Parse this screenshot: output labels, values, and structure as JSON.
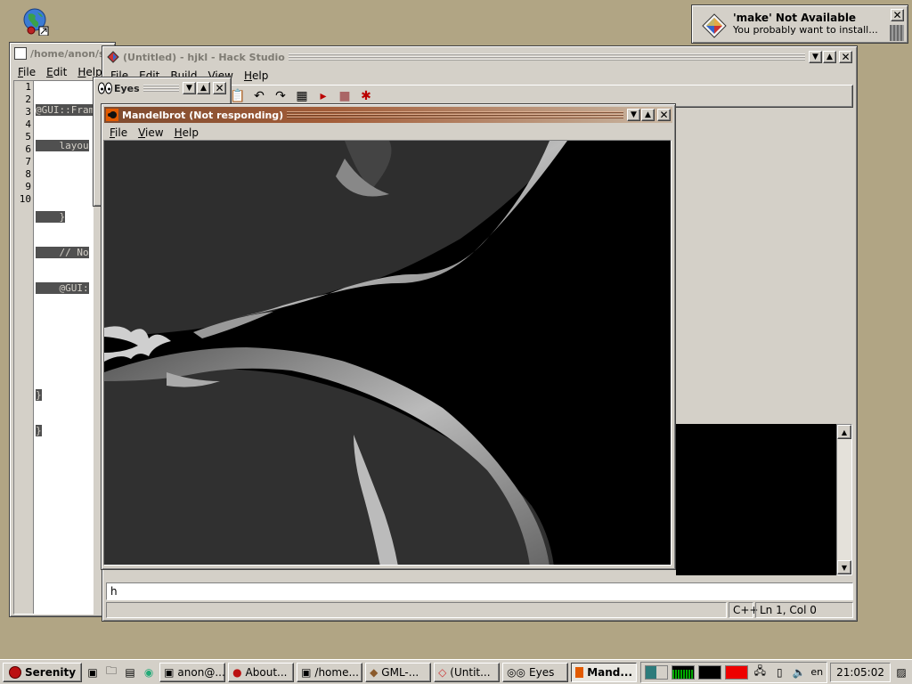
{
  "desktop": {
    "icon": "globe-icon"
  },
  "notification": {
    "title": "'make' Not Available",
    "message": "You probably want to install...",
    "icon": "package-icon"
  },
  "terminal_window": {
    "title": "/home/anon/s",
    "menu": [
      "File",
      "Edit",
      "Help"
    ]
  },
  "hackstudio": {
    "title": "(Untitled) - hjkl - Hack Studio",
    "menu": [
      "File",
      "Edit",
      "Build",
      "View",
      "Help"
    ],
    "code_lines": [
      {
        "num": "1",
        "text": "@GUI::Fram"
      },
      {
        "num": "2",
        "text": "    layou"
      },
      {
        "num": "3",
        "text": ""
      },
      {
        "num": "4",
        "text": "    }"
      },
      {
        "num": "5",
        "text": "    // No"
      },
      {
        "num": "6",
        "text": "    @GUI:"
      },
      {
        "num": "7",
        "text": ""
      },
      {
        "num": "8",
        "text": ""
      },
      {
        "num": "9",
        "text": "}"
      },
      {
        "num": "10",
        "text": "}"
      }
    ],
    "input_value": "h",
    "status": {
      "language": "C++",
      "position": "Ln 1, Col 0"
    }
  },
  "eyes_window": {
    "title": "Eyes"
  },
  "mandelbrot_window": {
    "title": "Mandelbrot (Not responding)",
    "menu": [
      "File",
      "View",
      "Help"
    ]
  },
  "taskbar": {
    "start_label": "Serenity",
    "tasks": [
      {
        "label": "anon@...",
        "icon": "terminal-icon"
      },
      {
        "label": "About...",
        "icon": "serenity-icon"
      },
      {
        "label": "/home...",
        "icon": "terminal-icon"
      },
      {
        "label": "GML-...",
        "icon": "book-icon"
      },
      {
        "label": "(Untit...",
        "icon": "hackstudio-icon"
      },
      {
        "label": "Eyes",
        "icon": "eyes-icon"
      },
      {
        "label": "Mand...",
        "icon": "mandelbrot-icon",
        "active": true
      }
    ],
    "keyboard_layout": "en",
    "clock": "21:05:02"
  }
}
